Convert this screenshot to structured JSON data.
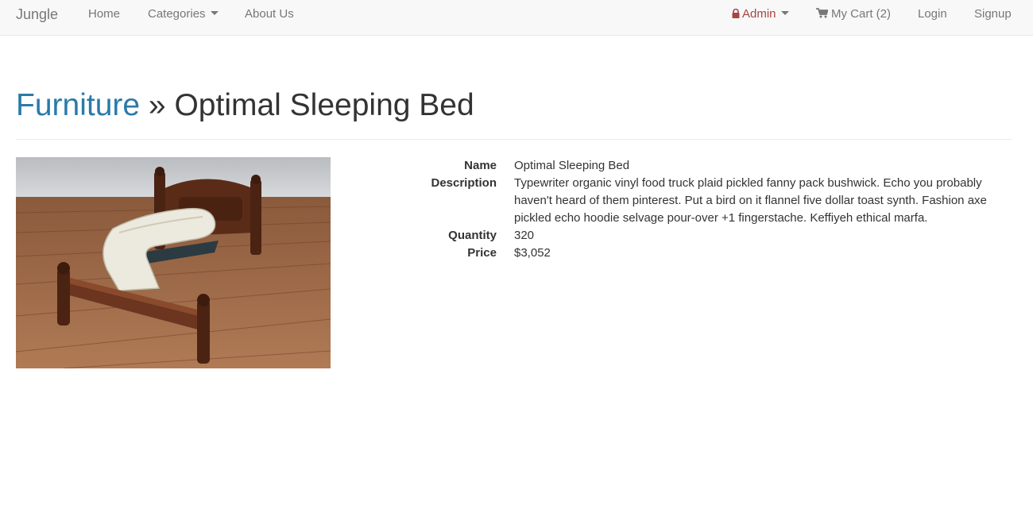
{
  "nav": {
    "brand": "Jungle",
    "home": "Home",
    "categories": "Categories",
    "about": "About Us",
    "admin": "Admin",
    "cart": "My Cart (2)",
    "login": "Login",
    "signup": "Signup",
    "admin_color": "#a94442"
  },
  "breadcrumb": {
    "category": "Furniture",
    "separator": "»",
    "product": "Optimal Sleeping Bed",
    "link_color": "#2a7aa9"
  },
  "product": {
    "image_alt": "bed-photo",
    "name_label": "Name",
    "name": "Optimal Sleeping Bed",
    "description_label": "Description",
    "description": "Typewriter organic vinyl food truck plaid pickled fanny pack bushwick. Echo you probably haven't heard of them pinterest. Put a bird on it flannel five dollar toast synth. Fashion axe pickled echo hoodie selvage pour-over +1 fingerstache. Keffiyeh ethical marfa.",
    "quantity_label": "Quantity",
    "quantity": "320",
    "price_label": "Price",
    "price": "$3,052"
  }
}
